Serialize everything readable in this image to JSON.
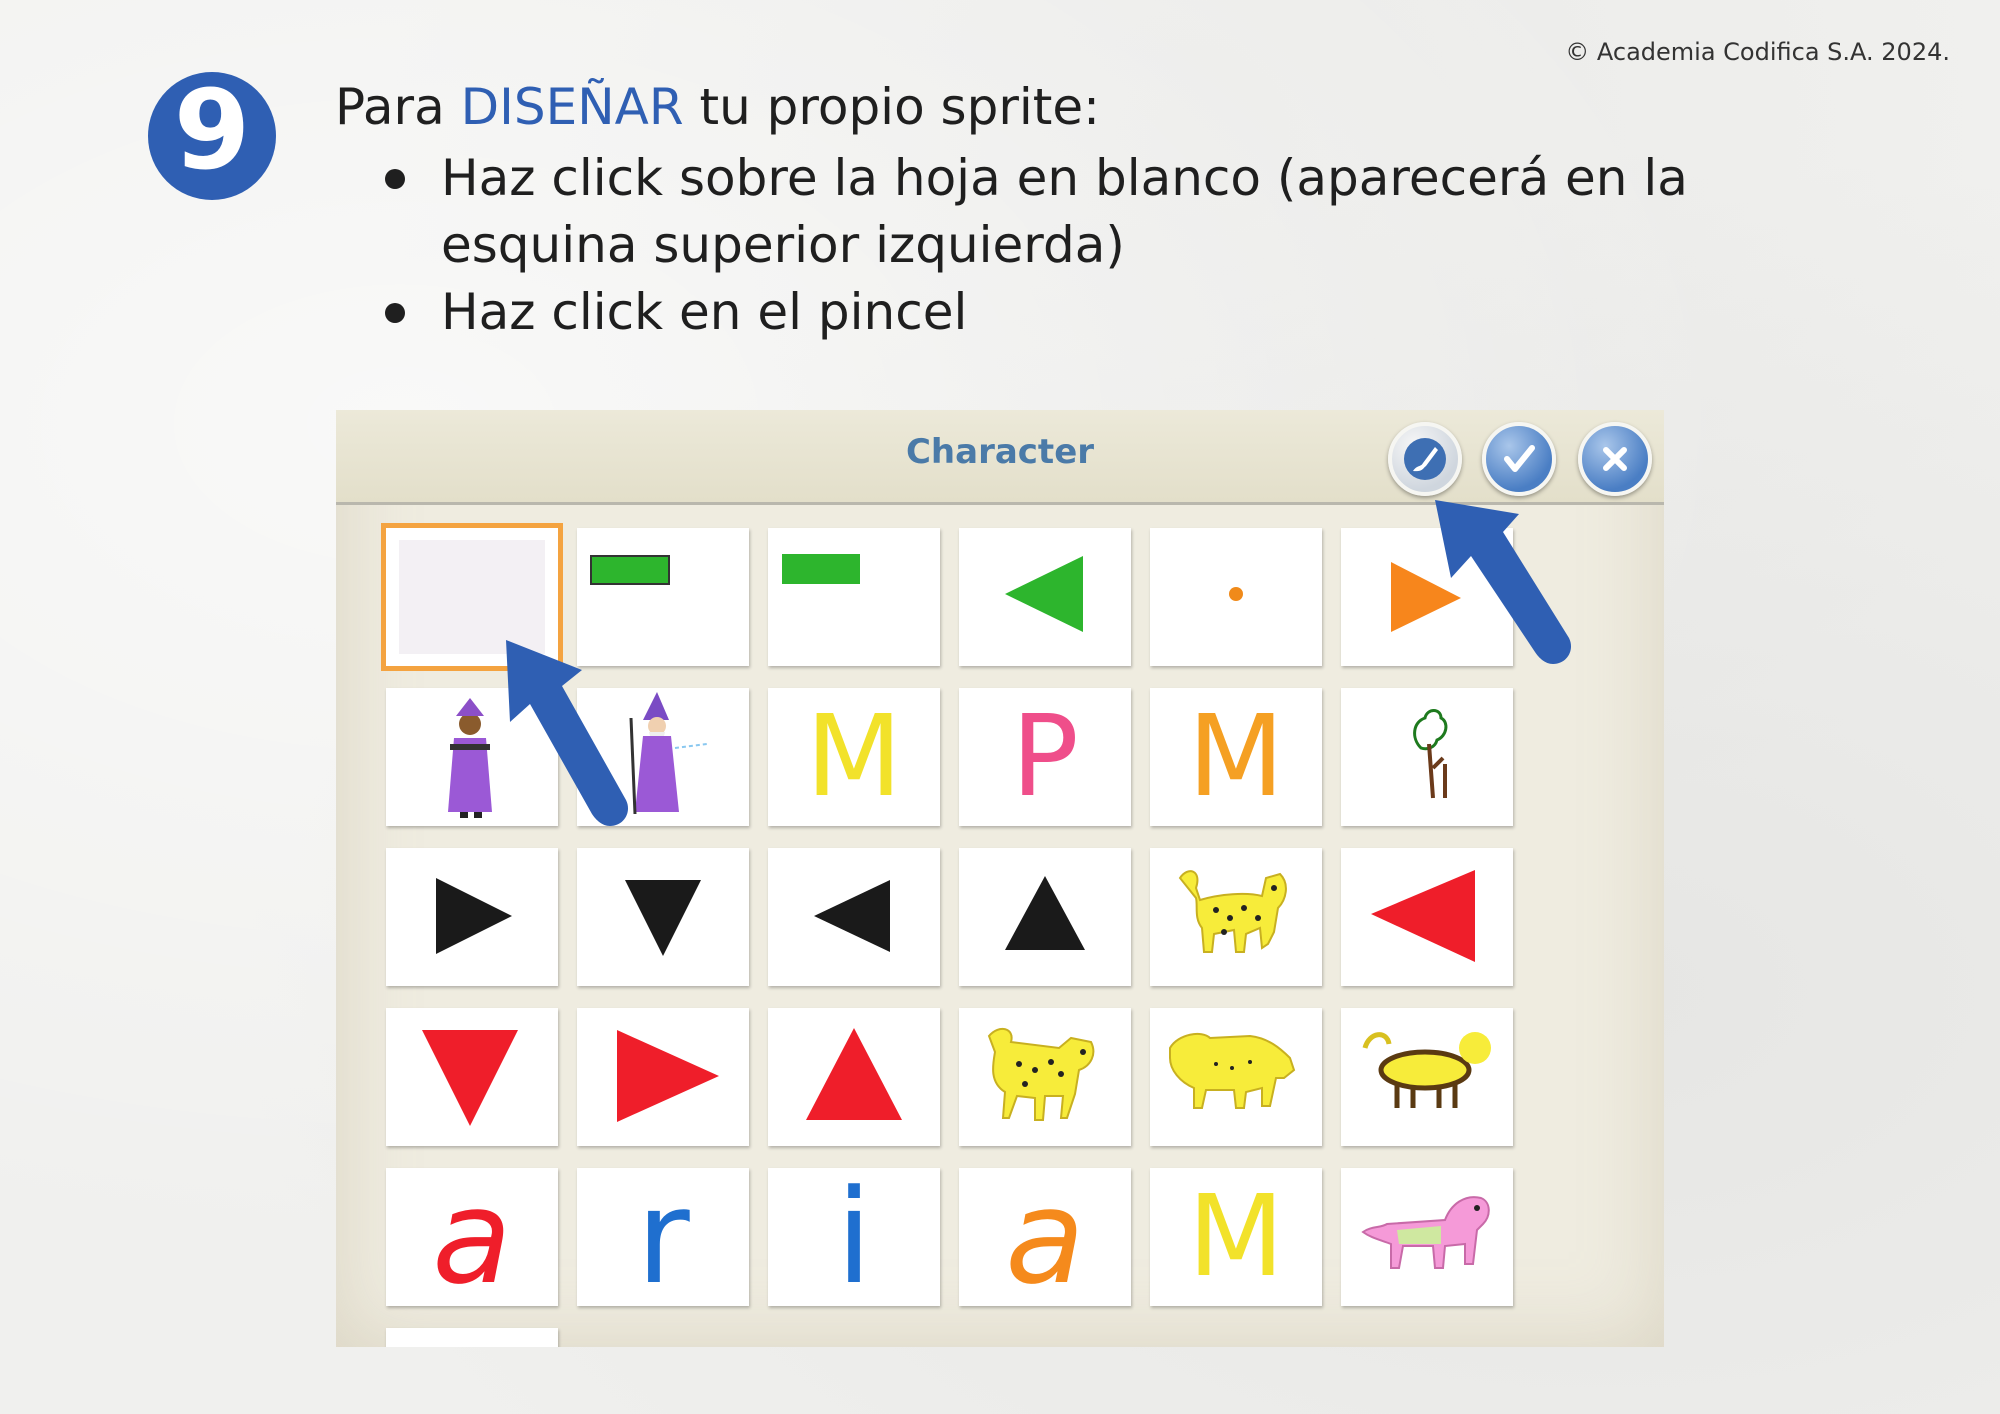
{
  "copyright": "© Academia Codifica S.A. 2024.",
  "step": "9",
  "heading": {
    "prefix": "Para ",
    "highlight": "DISEÑAR",
    "suffix": " tu propio sprite:"
  },
  "bullets": [
    "Haz click sobre la hoja en blanco (aparecerá en la esquina superior izquierda)",
    "Haz click en el pincel"
  ],
  "panel": {
    "title": "Character",
    "buttons": [
      "paintbrush-icon",
      "checkmark-icon",
      "close-icon"
    ]
  },
  "sprites": {
    "letters": {
      "r2c3": "M",
      "r2c4": "P",
      "r2c5": "M",
      "r5c1": "a",
      "r5c2": "r",
      "r5c3": "i",
      "r5c4": "a",
      "r5c5": "M"
    }
  },
  "colors": {
    "accent": "#2f5fb3",
    "title": "#4a7aa8",
    "selected_outline": "#f4a340",
    "arrow": "#2f5fb3"
  }
}
